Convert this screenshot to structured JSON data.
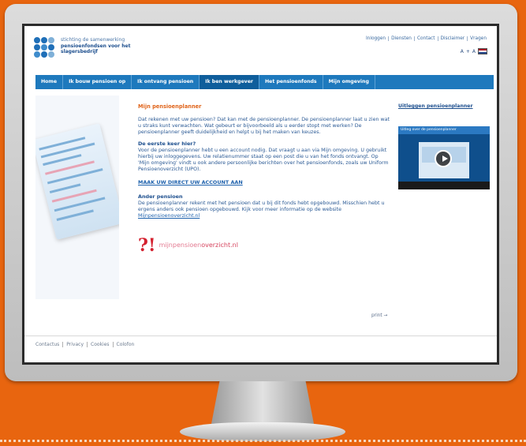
{
  "brand": {
    "line1": "stichting de samenwerking",
    "line2": "pensioenfondsen voor het",
    "line3": "slagersbedrijf"
  },
  "top_links": [
    "Inloggen",
    "Diensten",
    "Contact",
    "Disclaimer",
    "Vragen"
  ],
  "language": {
    "a_small": "A",
    "a_large": "A",
    "sep": "+"
  },
  "nav": [
    "Home",
    "Ik bouw pensioen op",
    "Ik ontvang pensioen",
    "Ik ben werkgever",
    "Het pensioenfonds",
    "Mijn omgeving"
  ],
  "main": {
    "title": "Mijn pensioenplanner",
    "intro": "Dat rekenen met uw pensioen? Dat kan met de pensioenplanner. De pensioenplanner laat u zien wat u straks kunt verwachten. Wat gebeurt er bijvoorbeeld als u eerder stopt met werken? De pensioenplanner geeft duidelijkheid en helpt u bij het maken van keuzes.",
    "first_time_heading": "De eerste keer hier?",
    "first_time_text": "Voor de pensioenplanner hebt u een account nodig. Dat vraagt u aan via Mijn omgeving. U gebruikt hierbij uw inloggegevens. Uw relatienummer staat op een post die u van het fonds ontvangt. Op 'Mijn omgeving' vindt u ook andere persoonlijke berichten over het pensioenfonds, zoals uw Uniform Pensioenoverzicht (UPO).",
    "cta": "MAAK UW DIRECT UW ACCOUNT AAN",
    "other_heading": "Ander pensioen",
    "other_text": "De pensioenplanner rekent met het pensioen dat u bij dit fonds hebt opgebouwd. Misschien hebt u ergens anders ook pensioen opgebouwd. Kijk voor meer informatie op de website",
    "other_link": "Mijnpensioenoverzicht.nl",
    "mpo_mark": "?!",
    "mpo_text_a": "mijnpensioen",
    "mpo_text_b": "overzicht.nl"
  },
  "sidebar": {
    "title": "Uitleggen pensioenplanner",
    "video_title": "Uitleg over de pensioenplanner"
  },
  "print_label": "print →",
  "footer": [
    "Contactus",
    "Privacy",
    "Cookies",
    "Colofon"
  ]
}
